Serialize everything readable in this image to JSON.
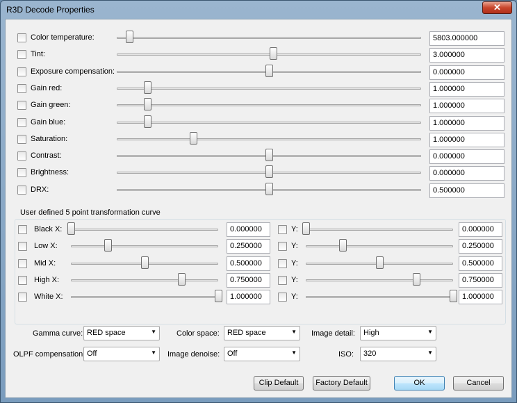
{
  "window": {
    "title": "R3D Decode Properties",
    "close_icon": "✕"
  },
  "params": [
    {
      "label": "Color temperature:",
      "value": "5803.000000",
      "pos": 0.04
    },
    {
      "label": "Tint:",
      "value": "3.000000",
      "pos": 0.513
    },
    {
      "label": "Exposure compensation:",
      "value": "0.000000",
      "pos": 0.5
    },
    {
      "label": "Gain red:",
      "value": "1.000000",
      "pos": 0.1
    },
    {
      "label": "Gain green:",
      "value": "1.000000",
      "pos": 0.1
    },
    {
      "label": "Gain blue:",
      "value": "1.000000",
      "pos": 0.1
    },
    {
      "label": "Saturation:",
      "value": "1.000000",
      "pos": 0.25
    },
    {
      "label": "Contrast:",
      "value": "0.000000",
      "pos": 0.5
    },
    {
      "label": "Brightness:",
      "value": "0.000000",
      "pos": 0.5
    },
    {
      "label": "DRX:",
      "value": "0.500000",
      "pos": 0.5
    }
  ],
  "curve": {
    "title": "User defined 5 point transformation curve",
    "y_label": "Y:",
    "points": [
      {
        "label": "Black X:",
        "x": "0.000000",
        "y": "0.000000"
      },
      {
        "label": "Low X:",
        "x": "0.250000",
        "y": "0.250000"
      },
      {
        "label": "Mid X:",
        "x": "0.500000",
        "y": "0.500000"
      },
      {
        "label": "High X:",
        "x": "0.750000",
        "y": "0.750000"
      },
      {
        "label": "White X:",
        "x": "1.000000",
        "y": "1.000000"
      }
    ]
  },
  "settings": {
    "gamma_label": "Gamma curve:",
    "gamma_value": "RED space",
    "colorspace_label": "Color space:",
    "colorspace_value": "RED space",
    "detail_label": "Image detail:",
    "detail_value": "High",
    "olpf_label": "OLPF compensation:",
    "olpf_value": "Off",
    "denoise_label": "Image denoise:",
    "denoise_value": "Off",
    "iso_label": "ISO:",
    "iso_value": "320",
    "dropdown_icon": "▼"
  },
  "buttons": {
    "clip_default": "Clip Default",
    "factory_default": "Factory Default",
    "ok": "OK",
    "cancel": "Cancel"
  }
}
